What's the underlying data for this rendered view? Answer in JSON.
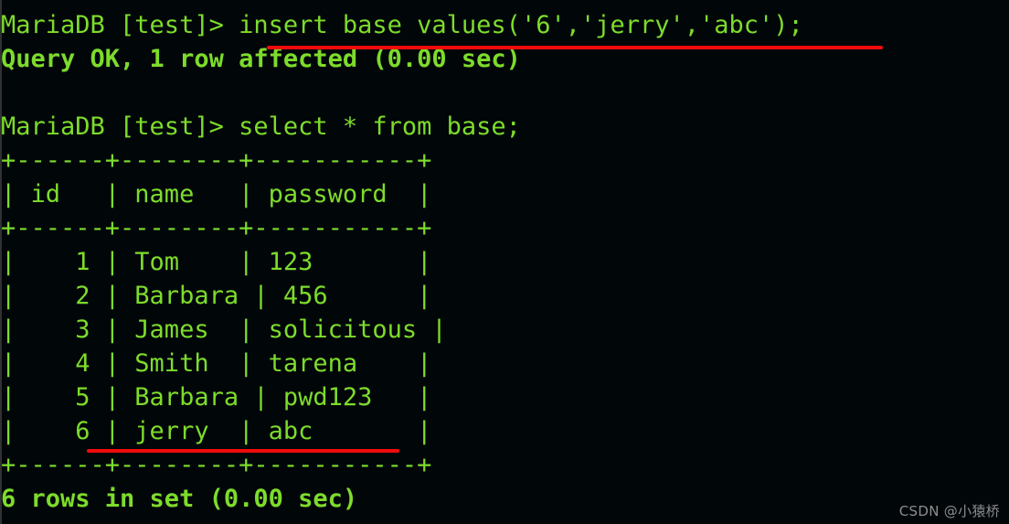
{
  "terminal": {
    "background_color": "#010609",
    "foreground_color": "#7ddc2b",
    "highlight_color": "#f10b0b",
    "lines": [
      {
        "id": "cmd-insert",
        "text": "MariaDB [test]> insert base values('6','jerry','abc');",
        "bold": false
      },
      {
        "id": "result-query-ok",
        "text": "Query OK, 1 row affected (0.00 sec)",
        "bold": true
      },
      {
        "id": "blank-1",
        "text": " ",
        "bold": false
      },
      {
        "id": "cmd-select",
        "text": "MariaDB [test]> select * from base;",
        "bold": false
      },
      {
        "id": "table-border-top",
        "text": "+------+--------+-----------+",
        "bold": false
      },
      {
        "id": "table-header",
        "text": "| id   | name   | password  |",
        "bold": false
      },
      {
        "id": "table-border-mid",
        "text": "+------+--------+-----------+",
        "bold": false
      },
      {
        "id": "table-row-1",
        "text": "|    1 | Tom    | 123       |",
        "bold": false
      },
      {
        "id": "table-row-2",
        "text": "|    2 | Barbara | 456      |",
        "bold": false
      },
      {
        "id": "table-row-3",
        "text": "|    3 | James  | solicitous |",
        "bold": false
      },
      {
        "id": "table-row-4",
        "text": "|    4 | Smith  | tarena    |",
        "bold": false
      },
      {
        "id": "table-row-5",
        "text": "|    5 | Barbara | pwd123   |",
        "bold": false
      },
      {
        "id": "table-row-6",
        "text": "|    6 | jerry  | abc       |",
        "bold": false
      },
      {
        "id": "table-border-bot",
        "text": "+------+--------+-----------+",
        "bold": false
      },
      {
        "id": "result-row-count",
        "text": "6 rows in set (0.00 sec)",
        "bold": true
      }
    ]
  },
  "query_result": {
    "type": "table",
    "columns": [
      "id",
      "name",
      "password"
    ],
    "rows": [
      [
        "1",
        "Tom",
        "123"
      ],
      [
        "2",
        "Barbara",
        "456"
      ],
      [
        "3",
        "James",
        "solicitous"
      ],
      [
        "4",
        "Smith",
        "tarena"
      ],
      [
        "5",
        "Barbara",
        "pwd123"
      ],
      [
        "6",
        "jerry",
        "abc"
      ]
    ],
    "row_count_text": "6 rows in set (0.00 sec)",
    "insert_status_text": "Query OK, 1 row affected (0.00 sec)"
  },
  "annotations": {
    "underline_insert_statement": "insert base values('6','jerry','abc');",
    "underline_inserted_row": "6 | jerry"
  },
  "watermark": {
    "text": "CSDN @小猿桥"
  }
}
